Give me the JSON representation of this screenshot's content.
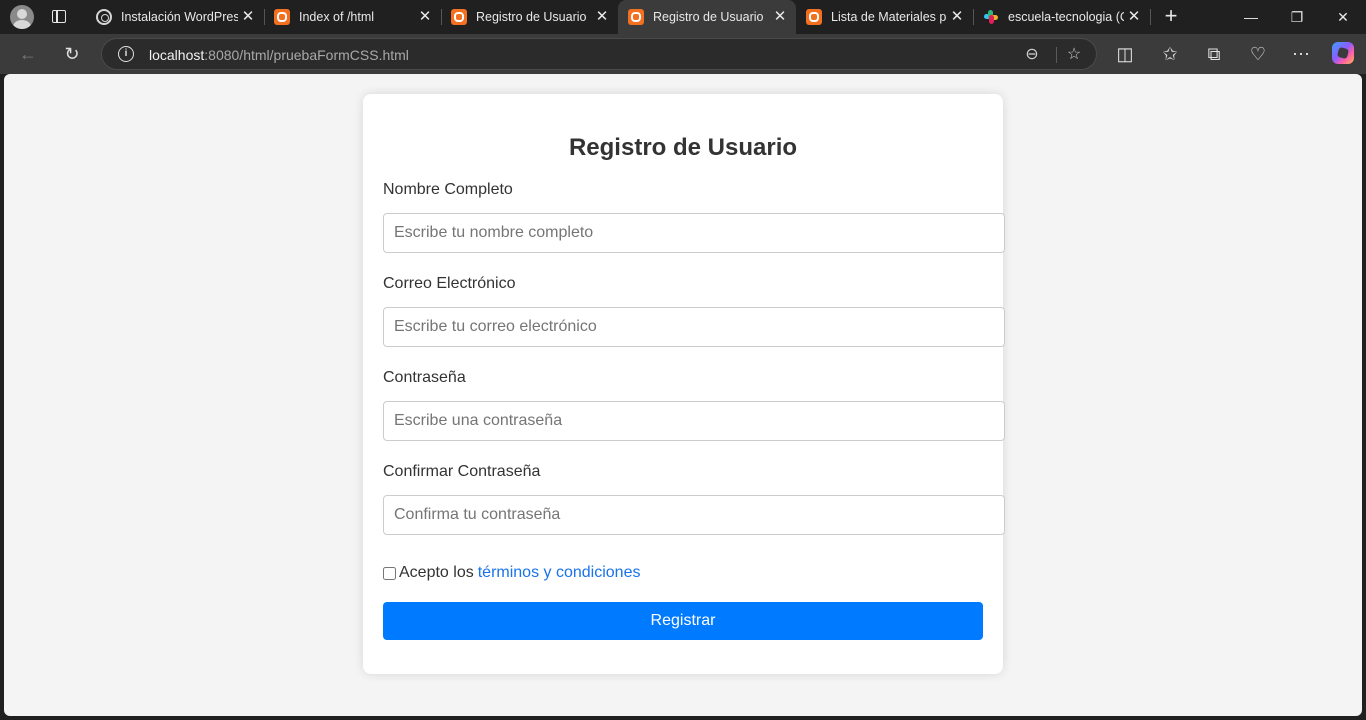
{
  "browser": {
    "tabs": [
      {
        "title": "Instalación WordPress",
        "favicon": "wordpress-icon",
        "active": false
      },
      {
        "title": "Index of /html",
        "favicon": "xampp-icon",
        "active": false
      },
      {
        "title": "Registro de Usuario",
        "favicon": "xampp-icon",
        "active": false
      },
      {
        "title": "Registro de Usuario",
        "favicon": "xampp-icon",
        "active": true
      },
      {
        "title": "Lista de Materiales pa",
        "favicon": "xampp-icon",
        "active": false
      },
      {
        "title": "escuela-tecnologia (C",
        "favicon": "slack-icon",
        "active": false
      }
    ],
    "close_glyph": "✕",
    "new_tab_glyph": "+",
    "address": {
      "host": "localhost",
      "rest": ":8080/html/pruebaFormCSS.html"
    },
    "window_controls": {
      "minimize": "—",
      "maximize": "❐",
      "close": "✕"
    }
  },
  "form": {
    "title": "Registro de Usuario",
    "fields": [
      {
        "label": "Nombre Completo",
        "placeholder": "Escribe tu nombre completo",
        "type": "text"
      },
      {
        "label": "Correo Electrónico",
        "placeholder": "Escribe tu correo electrónico",
        "type": "email"
      },
      {
        "label": "Contraseña",
        "placeholder": "Escribe una contraseña",
        "type": "password"
      },
      {
        "label": "Confirmar Contraseña",
        "placeholder": "Confirma tu contraseña",
        "type": "password"
      }
    ],
    "terms_prefix": "Acepto los",
    "terms_link": "términos y condiciones",
    "terms_checked": false,
    "submit_label": "Registrar"
  },
  "colors": {
    "accent": "#007bff",
    "link": "#1a73e8",
    "page_bg": "#f4f4f4",
    "chrome_bg": "#202020"
  }
}
